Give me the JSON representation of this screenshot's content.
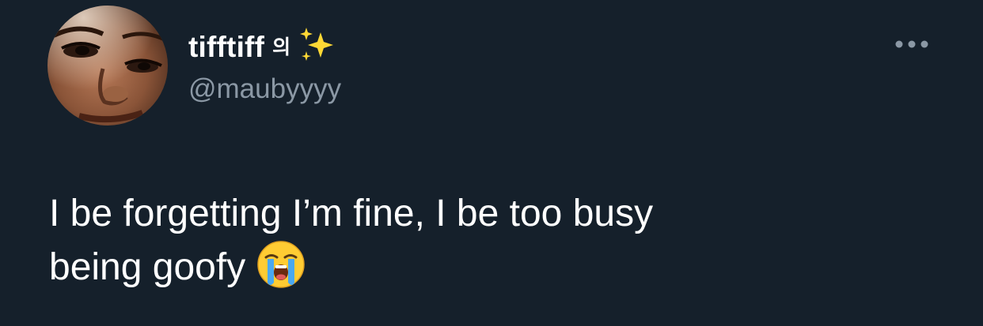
{
  "tweet": {
    "author": {
      "display_name": "tifftiff",
      "display_name_char": "의",
      "display_name_emoji": "sparkles-icon",
      "handle": "@maubyyyy",
      "avatar": "profile-photo"
    },
    "text_lines": [
      "I be forgetting I’m fine, I be too busy",
      "being goofy"
    ],
    "text_emoji": "loudly-crying-face-icon",
    "more_icon": "more-dots-icon"
  },
  "colors": {
    "background": "#15202b",
    "primary_text": "#ffffff",
    "secondary_text": "#8b98a5"
  }
}
